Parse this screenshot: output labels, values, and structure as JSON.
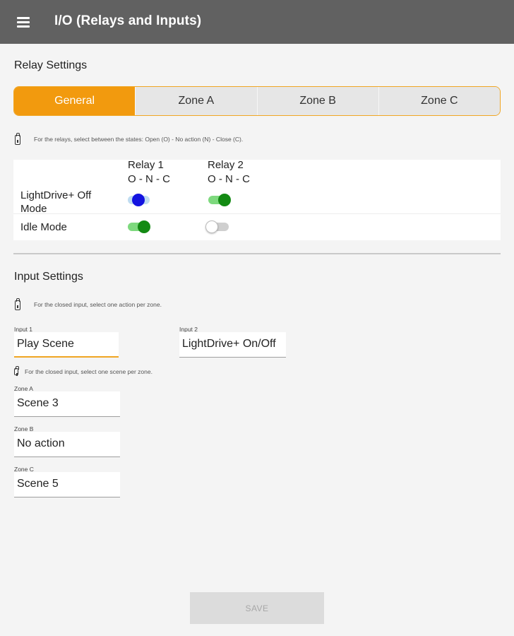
{
  "appbar": {
    "title": "I/O (Relays and Inputs)",
    "menu_icon": "menu-icon"
  },
  "relay_settings": {
    "title": "Relay Settings",
    "tabs": [
      {
        "label": "General",
        "active": true
      },
      {
        "label": "Zone A",
        "active": false
      },
      {
        "label": "Zone B",
        "active": false
      },
      {
        "label": "Zone C",
        "active": false
      }
    ],
    "hint": "For the relays, select between the states: Open (O) - No action (N) - Close (C).",
    "columns": [
      {
        "title": "Relay 1",
        "subtitle": "O - N - C"
      },
      {
        "title": "Relay 2",
        "subtitle": "O - N - C"
      }
    ],
    "rows": [
      {
        "label": "LightDrive+ Off Mode",
        "relay1": "N",
        "relay2": "C"
      },
      {
        "label": "Idle Mode",
        "relay1": "C",
        "relay2": "O"
      }
    ]
  },
  "input_settings": {
    "title": "Input Settings",
    "hint": "For the closed input, select one action per zone.",
    "input1": {
      "label": "Input 1",
      "value": "Play Scene"
    },
    "input2": {
      "label": "Input 2",
      "value": "LightDrive+ On/Off"
    },
    "scene_hint": "For the closed input, select one scene per zone.",
    "zones": [
      {
        "label": "Zone A",
        "value": "Scene 3"
      },
      {
        "label": "Zone B",
        "value": "No action"
      },
      {
        "label": "Zone C",
        "value": "Scene 5"
      }
    ]
  },
  "footer": {
    "save_label": "SAVE"
  },
  "colors": {
    "accent": "#f29a0e",
    "appbar": "#616161",
    "switch_on": "#138a13",
    "switch_mid": "#1313e0"
  }
}
